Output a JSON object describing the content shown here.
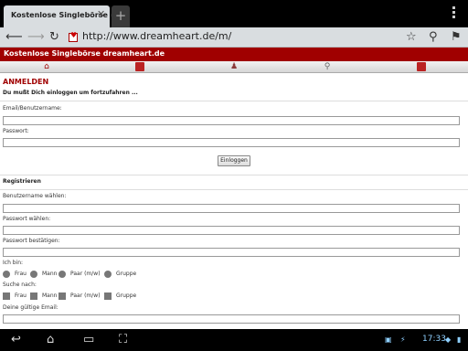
{
  "browser": {
    "tab_title": "Kostenlose Singlebörse d...",
    "tab_close": "✕",
    "new_tab": "+",
    "url": "http://www.dreamheart.de/m/"
  },
  "site": {
    "title": "Kostenlose Singlebörse dreamheart.de",
    "nav_icons": [
      "home-icon",
      "mail-icon",
      "people-icon",
      "search-icon",
      "briefcase-icon"
    ]
  },
  "login": {
    "heading": "ANMELDEN",
    "subheading": "Du mußt Dich einloggen um fortzufahren ...",
    "email_label": "Email/Benutzername:",
    "password_label": "Passwort:",
    "login_button": "Einloggen"
  },
  "register": {
    "heading": "Registrieren",
    "username_label": "Benutzername wählen:",
    "password_label": "Passwort wählen:",
    "confirm_label": "Passwort bestätigen:",
    "iam_label": "Ich bin:",
    "iam_options": [
      "Frau",
      "Mann",
      "Paar (m/w)",
      "Gruppe"
    ],
    "seeking_label": "Suche nach:",
    "seeking_options": [
      "Frau",
      "Mann",
      "Paar (m/w)",
      "Gruppe"
    ],
    "email_label": "Deine gültige Email:"
  },
  "system": {
    "time": "17:33"
  },
  "colors": {
    "brand": "#a00000",
    "status_blue": "#8fd0ff"
  }
}
